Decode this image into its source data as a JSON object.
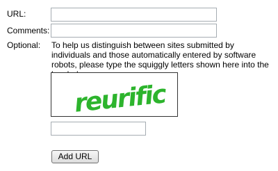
{
  "form": {
    "url_label": "URL:",
    "url_value": "",
    "comments_label": "Comments:",
    "comments_value": "",
    "optional_label": "Optional:",
    "instructions": "To help us distinguish between sites submitted by individuals and those automatically entered by software robots, please type the squiggly letters shown here into the box below.",
    "captcha_text": "reurific",
    "captcha_value": "",
    "submit_label": "Add URL"
  },
  "colors": {
    "captcha_text": "#2db42d",
    "field_border": "#a5acb2"
  }
}
